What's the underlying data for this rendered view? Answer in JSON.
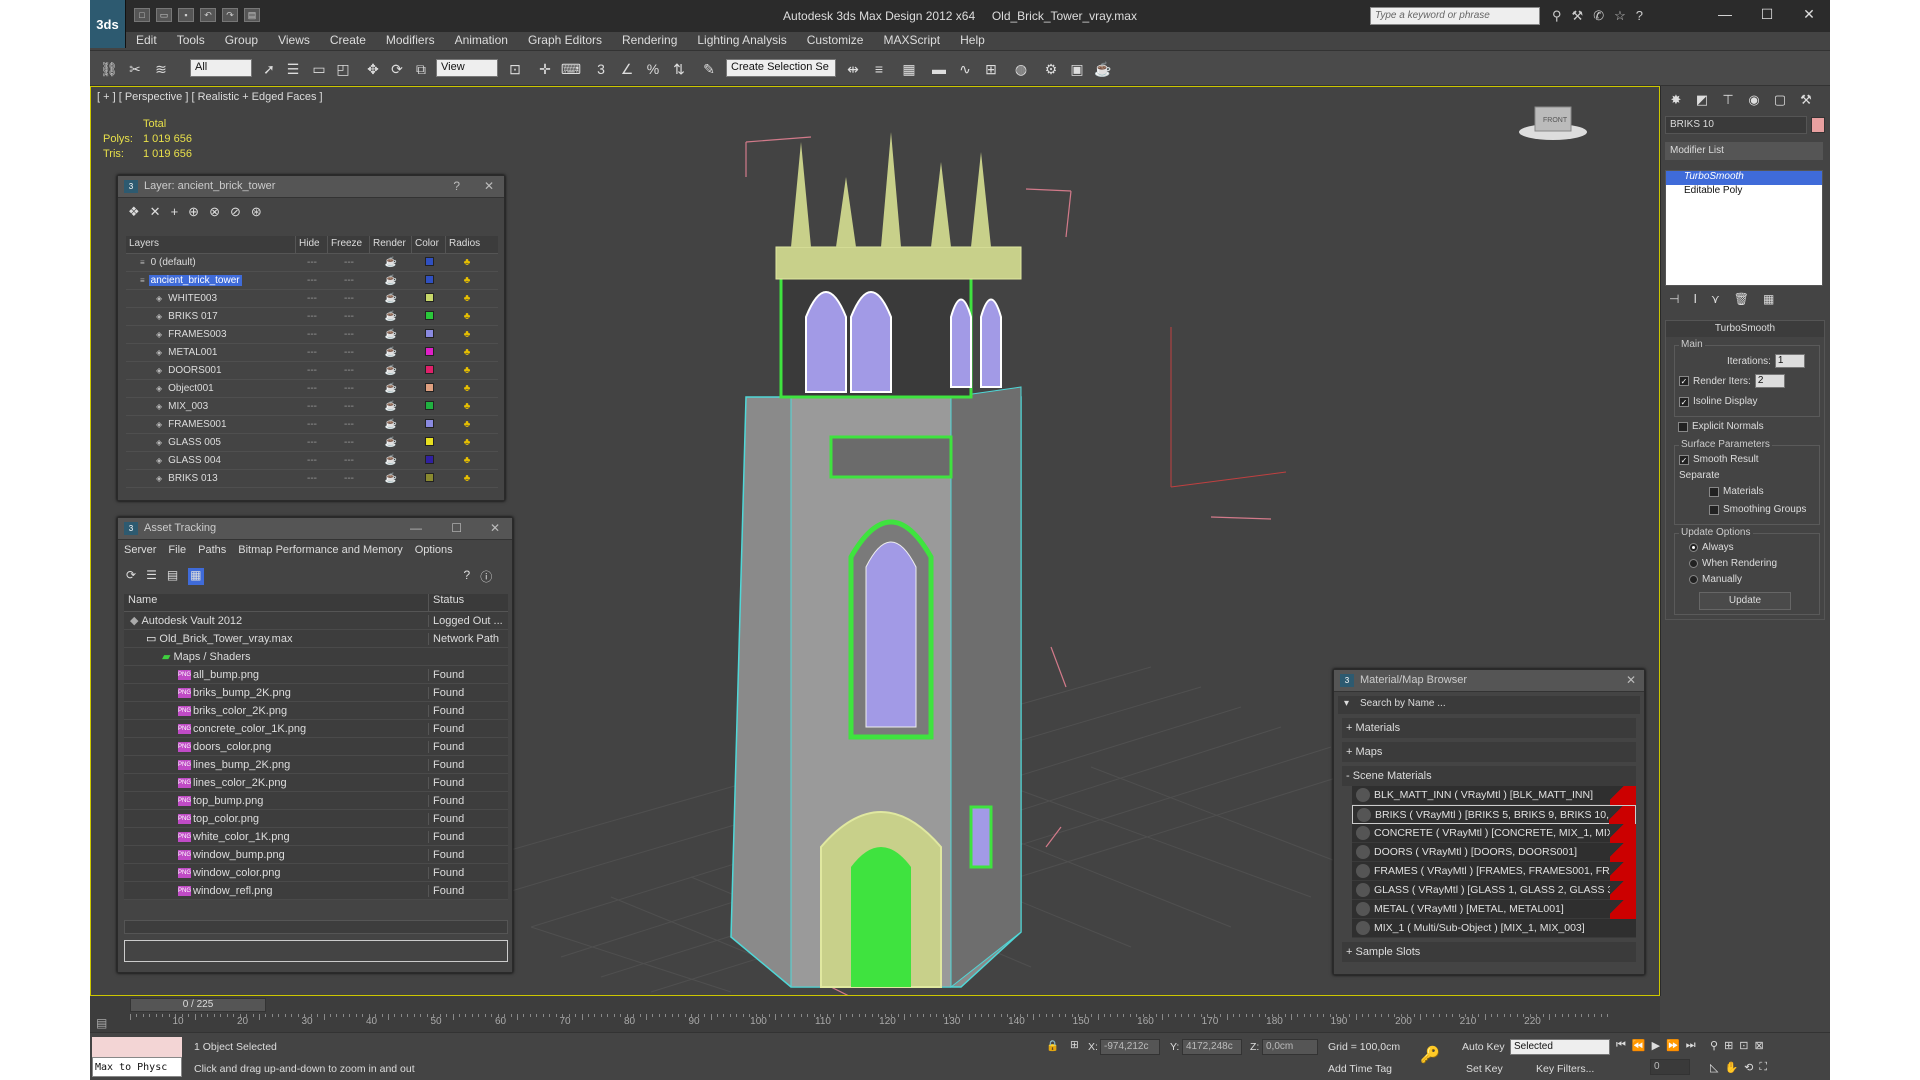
{
  "window": {
    "app_icon": "3ds",
    "title": "Autodesk 3ds Max Design 2012 x64",
    "file": "Old_Brick_Tower_vray.max",
    "search_placeholder": "Type a keyword or phrase",
    "minimize": "—",
    "maximize": "☐",
    "close": "✕"
  },
  "menu": [
    "Edit",
    "Tools",
    "Group",
    "Views",
    "Create",
    "Modifiers",
    "Animation",
    "Graph Editors",
    "Rendering",
    "Lighting Analysis",
    "Customize",
    "MAXScript",
    "Help"
  ],
  "toolbar": {
    "selection_filter": "All",
    "ref_coord": "View",
    "named_selection": "Create Selection Se"
  },
  "viewport": {
    "label": "[ + ] [ Perspective ] [ Realistic + Edged Faces ]",
    "stats": {
      "header": "Total",
      "polys_label": "Polys:",
      "polys": "1 019 656",
      "tris_label": "Tris:",
      "tris": "1 019 656"
    },
    "viewcube_label": "FRONT"
  },
  "layer_panel": {
    "title": "Layer: ancient_brick_tower",
    "help": "?",
    "close": "✕",
    "columns": [
      "Layers",
      "Hide",
      "Freeze",
      "Render",
      "Color",
      "Radios"
    ],
    "rows": [
      {
        "name": "0 (default)",
        "color": "#3050c0",
        "level": 0,
        "selected": false
      },
      {
        "name": "ancient_brick_tower",
        "color": "#3050c0",
        "level": 0,
        "selected": true
      },
      {
        "name": "WHITE003",
        "color": "#c8d86a",
        "level": 1,
        "selected": false
      },
      {
        "name": "BRIKS 017",
        "color": "#2ac83a",
        "level": 1,
        "selected": false
      },
      {
        "name": "FRAMES003",
        "color": "#8a8ae0",
        "level": 1,
        "selected": false
      },
      {
        "name": "METAL001",
        "color": "#e020c8",
        "level": 1,
        "selected": false
      },
      {
        "name": "DOORS001",
        "color": "#e0206a",
        "level": 1,
        "selected": false
      },
      {
        "name": "Object001",
        "color": "#e0a080",
        "level": 1,
        "selected": false
      },
      {
        "name": "MIX_003",
        "color": "#20b040",
        "level": 1,
        "selected": false
      },
      {
        "name": "FRAMES001",
        "color": "#8a8ae0",
        "level": 1,
        "selected": false
      },
      {
        "name": "GLASS 005",
        "color": "#e8e020",
        "level": 1,
        "selected": false
      },
      {
        "name": "GLASS 004",
        "color": "#3020a0",
        "level": 1,
        "selected": false
      },
      {
        "name": "BRIKS 013",
        "color": "#8a8a30",
        "level": 1,
        "selected": false
      }
    ]
  },
  "asset_panel": {
    "title": "Asset Tracking",
    "menu": [
      "Server",
      "File",
      "Paths",
      "Bitmap Performance and Memory",
      "Options"
    ],
    "columns": [
      "Name",
      "Status"
    ],
    "rows": [
      {
        "name": "Autodesk Vault 2012",
        "status": "Logged Out ...",
        "level": 0,
        "type": "vault"
      },
      {
        "name": "Old_Brick_Tower_vray.max",
        "status": "Network Path",
        "level": 1,
        "type": "file"
      },
      {
        "name": "Maps / Shaders",
        "status": "",
        "level": 2,
        "type": "folder"
      },
      {
        "name": "all_bump.png",
        "status": "Found",
        "level": 3,
        "type": "png"
      },
      {
        "name": "briks_bump_2K.png",
        "status": "Found",
        "level": 3,
        "type": "png"
      },
      {
        "name": "briks_color_2K.png",
        "status": "Found",
        "level": 3,
        "type": "png"
      },
      {
        "name": "concrete_color_1K.png",
        "status": "Found",
        "level": 3,
        "type": "png"
      },
      {
        "name": "doors_color.png",
        "status": "Found",
        "level": 3,
        "type": "png"
      },
      {
        "name": "lines_bump_2K.png",
        "status": "Found",
        "level": 3,
        "type": "png"
      },
      {
        "name": "lines_color_2K.png",
        "status": "Found",
        "level": 3,
        "type": "png"
      },
      {
        "name": "top_bump.png",
        "status": "Found",
        "level": 3,
        "type": "png"
      },
      {
        "name": "top_color.png",
        "status": "Found",
        "level": 3,
        "type": "png"
      },
      {
        "name": "white_color_1K.png",
        "status": "Found",
        "level": 3,
        "type": "png"
      },
      {
        "name": "window_bump.png",
        "status": "Found",
        "level": 3,
        "type": "png"
      },
      {
        "name": "window_color.png",
        "status": "Found",
        "level": 3,
        "type": "png"
      },
      {
        "name": "window_refl.png",
        "status": "Found",
        "level": 3,
        "type": "png"
      }
    ]
  },
  "material_browser": {
    "title": "Material/Map Browser",
    "search_placeholder": "Search by Name ...",
    "sections": [
      "+ Materials",
      "+ Maps",
      "- Scene Materials",
      "+ Sample Slots"
    ],
    "materials": [
      "BLK_MATT_INN ( VRayMtl ) [BLK_MATT_INN]",
      "BRIKS ( VRayMtl ) [BRIKS 5, BRIKS 9, BRIKS 10,...",
      "CONCRETE ( VRayMtl ) [CONCRETE, MIX_1, MIX...",
      "DOORS ( VRayMtl ) [DOORS, DOORS001]",
      "FRAMES ( VRayMtl ) [FRAMES, FRAMES001, FRA...",
      "GLASS ( VRayMtl ) [GLASS 1, GLASS 2, GLASS 3,...",
      "METAL ( VRayMtl ) [METAL, METAL001]",
      "MIX_1 ( Multi/Sub-Object ) [MIX_1, MIX_003]"
    ]
  },
  "command_panel": {
    "object_name": "BRIKS 10",
    "modifier_list": "Modifier List",
    "stack": [
      "TurboSmooth",
      "Editable Poly"
    ],
    "rollout_title": "TurboSmooth",
    "main_group": "Main",
    "iterations_label": "Iterations:",
    "iterations": "1",
    "render_iters_label": "Render Iters:",
    "render_iters": "2",
    "isoline": "Isoline Display",
    "explicit_normals": "Explicit Normals",
    "surface_group": "Surface Parameters",
    "smooth_result": "Smooth Result",
    "separate": "Separate",
    "materials": "Materials",
    "smoothing_groups": "Smoothing Groups",
    "update_group": "Update Options",
    "always": "Always",
    "when_rendering": "When Rendering",
    "manually": "Manually",
    "update_button": "Update"
  },
  "timeline": {
    "slider": "0 / 225",
    "ticks": [
      "10",
      "20",
      "30",
      "40",
      "50",
      "60",
      "70",
      "80",
      "90",
      "100",
      "110",
      "120",
      "130",
      "140",
      "150",
      "160",
      "170",
      "180",
      "190",
      "200",
      "210",
      "220"
    ]
  },
  "status": {
    "maxscript": "Max to Physc",
    "selected": "1 Object Selected",
    "prompt": "Click and drag up-and-down to zoom in and out",
    "x_label": "X:",
    "x_val": "-974,212c",
    "y_label": "Y:",
    "y_val": "4172,248c",
    "z_label": "Z:",
    "z_val": "0,0cm",
    "grid": "Grid = 100,0cm",
    "add_time_tag": "Add Time Tag",
    "auto_key": "Auto Key",
    "selected_drop": "Selected",
    "set_key": "Set Key",
    "key_filters": "Key Filters...",
    "frame": "0"
  }
}
